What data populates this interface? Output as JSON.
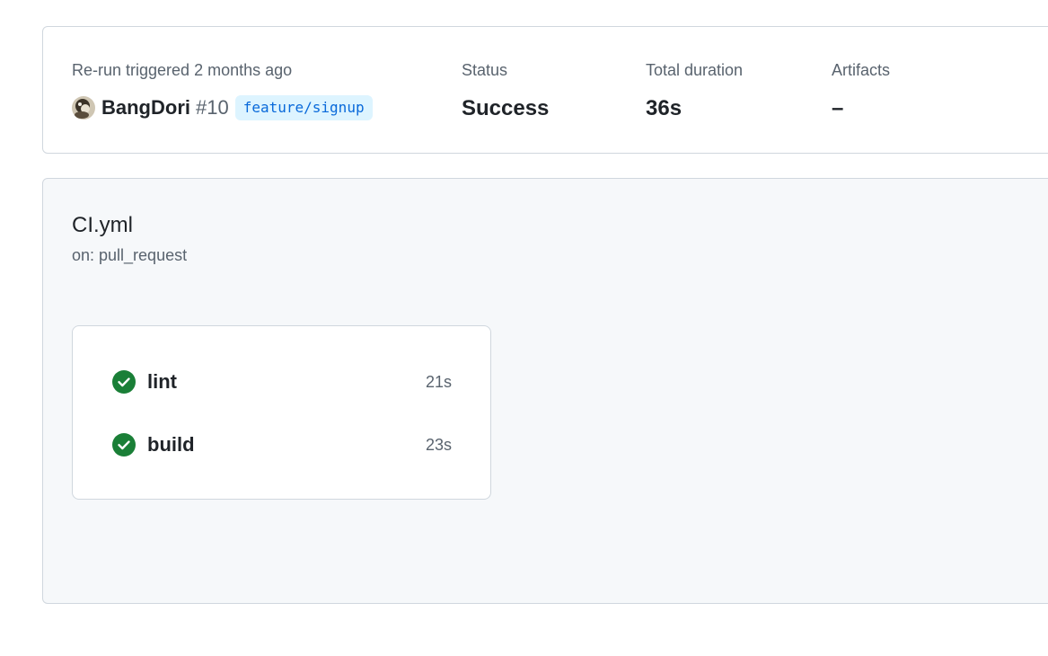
{
  "summary": {
    "trigger_label": "Re-run triggered 2 months ago",
    "actor": "BangDori",
    "run_number": "#10",
    "branch": "feature/signup",
    "status_label": "Status",
    "status_value": "Success",
    "duration_label": "Total duration",
    "duration_value": "36s",
    "artifacts_label": "Artifacts",
    "artifacts_value": "–"
  },
  "workflow": {
    "file": "CI.yml",
    "trigger": "on: pull_request",
    "jobs": [
      {
        "name": "lint",
        "duration": "21s",
        "status": "success",
        "icon": "check-circle-icon"
      },
      {
        "name": "build",
        "duration": "23s",
        "status": "success",
        "icon": "check-circle-icon"
      }
    ]
  },
  "colors": {
    "success": "#1a7f37",
    "border": "#d0d7de",
    "muted": "#59636e",
    "branch_bg": "#ddf4ff",
    "branch_fg": "#0969da"
  }
}
